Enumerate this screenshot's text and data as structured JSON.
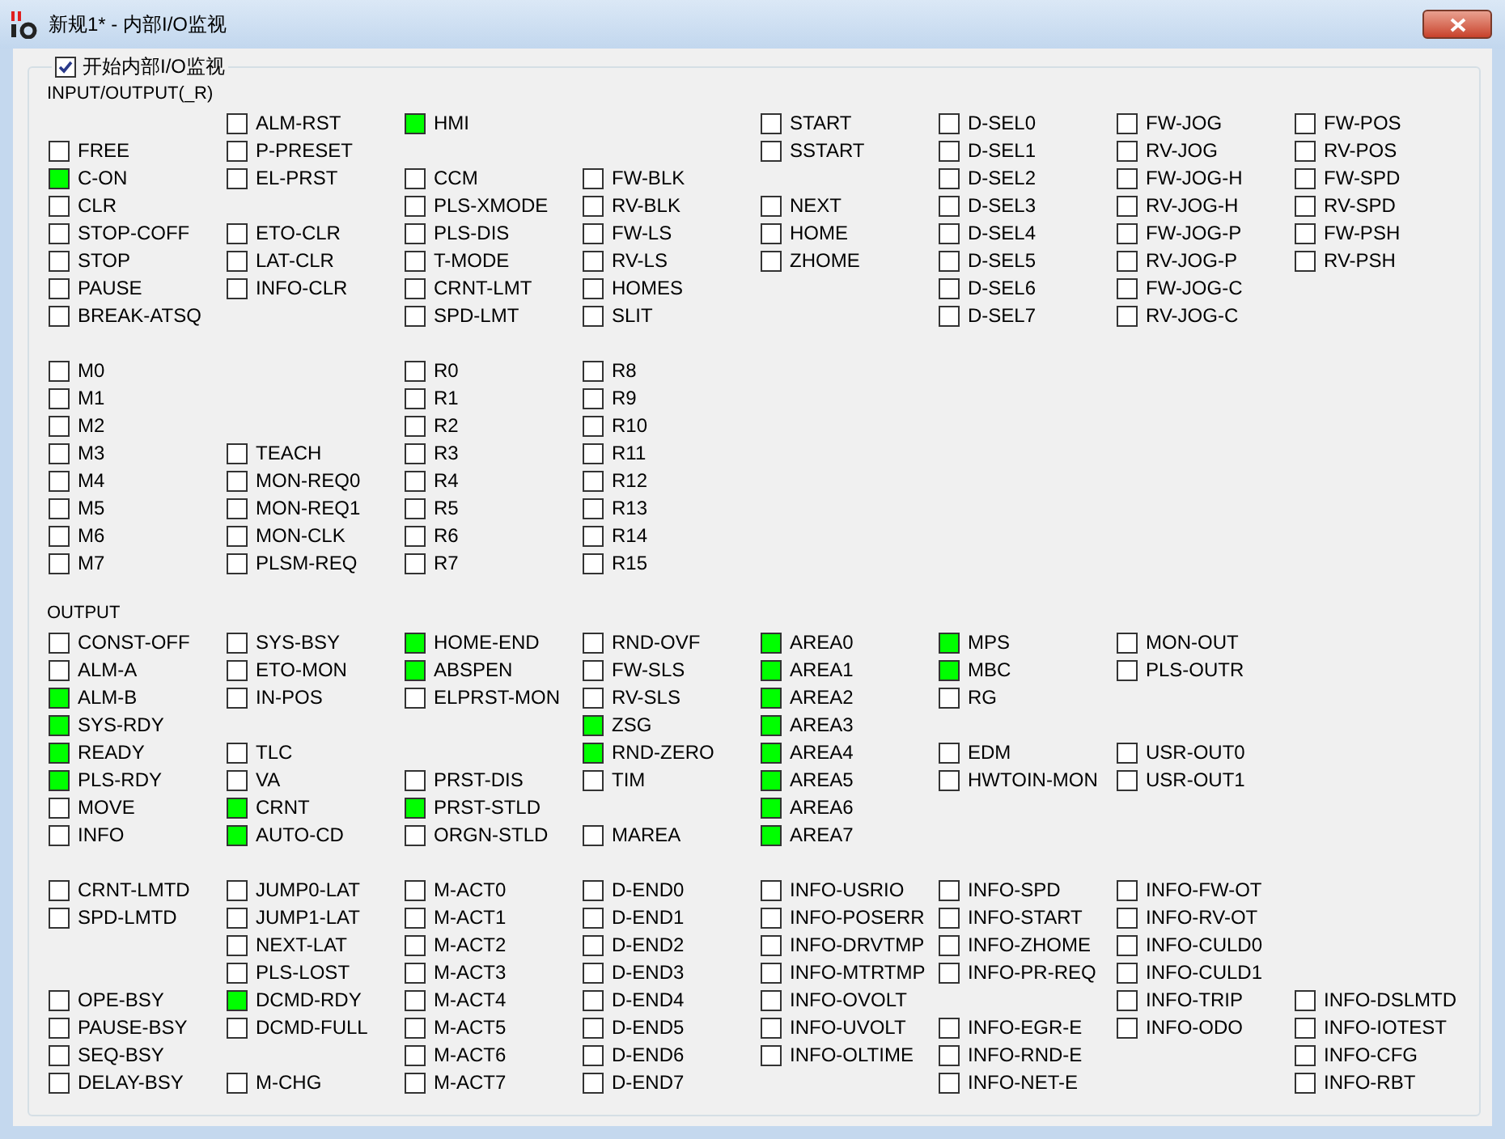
{
  "window": {
    "title": "新规1* - 内部I/O监视"
  },
  "monitor_toggle": {
    "label": "开始内部I/O监视",
    "checked": true
  },
  "sections": [
    {
      "title": "INPUT/OUTPUT(_R)",
      "rows": [
        {
          "kind": "row",
          "cells": [
            {
              "kind": "empty"
            },
            {
              "kind": "indicator",
              "label": "ALM-RST",
              "on": false
            },
            {
              "kind": "indicator",
              "label": "HMI",
              "on": true
            },
            {
              "kind": "empty"
            },
            {
              "kind": "indicator",
              "label": "START",
              "on": false
            },
            {
              "kind": "indicator",
              "label": "D-SEL0",
              "on": false
            },
            {
              "kind": "indicator",
              "label": "FW-JOG",
              "on": false
            },
            {
              "kind": "indicator",
              "label": "FW-POS",
              "on": false
            }
          ]
        },
        {
          "kind": "row",
          "cells": [
            {
              "kind": "indicator",
              "label": "FREE",
              "on": false
            },
            {
              "kind": "indicator",
              "label": "P-PRESET",
              "on": false
            },
            {
              "kind": "empty"
            },
            {
              "kind": "empty"
            },
            {
              "kind": "indicator",
              "label": "SSTART",
              "on": false
            },
            {
              "kind": "indicator",
              "label": "D-SEL1",
              "on": false
            },
            {
              "kind": "indicator",
              "label": "RV-JOG",
              "on": false
            },
            {
              "kind": "indicator",
              "label": "RV-POS",
              "on": false
            }
          ]
        },
        {
          "kind": "row",
          "cells": [
            {
              "kind": "indicator",
              "label": "C-ON",
              "on": true
            },
            {
              "kind": "indicator",
              "label": "EL-PRST",
              "on": false
            },
            {
              "kind": "indicator",
              "label": "CCM",
              "on": false
            },
            {
              "kind": "indicator",
              "label": "FW-BLK",
              "on": false
            },
            {
              "kind": "empty"
            },
            {
              "kind": "indicator",
              "label": "D-SEL2",
              "on": false
            },
            {
              "kind": "indicator",
              "label": "FW-JOG-H",
              "on": false
            },
            {
              "kind": "indicator",
              "label": "FW-SPD",
              "on": false
            }
          ]
        },
        {
          "kind": "row",
          "cells": [
            {
              "kind": "indicator",
              "label": "CLR",
              "on": false
            },
            {
              "kind": "empty"
            },
            {
              "kind": "indicator",
              "label": "PLS-XMODE",
              "on": false
            },
            {
              "kind": "indicator",
              "label": "RV-BLK",
              "on": false
            },
            {
              "kind": "indicator",
              "label": "NEXT",
              "on": false
            },
            {
              "kind": "indicator",
              "label": "D-SEL3",
              "on": false
            },
            {
              "kind": "indicator",
              "label": "RV-JOG-H",
              "on": false
            },
            {
              "kind": "indicator",
              "label": "RV-SPD",
              "on": false
            }
          ]
        },
        {
          "kind": "row",
          "cells": [
            {
              "kind": "indicator",
              "label": "STOP-COFF",
              "on": false
            },
            {
              "kind": "indicator",
              "label": "ETO-CLR",
              "on": false
            },
            {
              "kind": "indicator",
              "label": "PLS-DIS",
              "on": false
            },
            {
              "kind": "indicator",
              "label": "FW-LS",
              "on": false
            },
            {
              "kind": "indicator",
              "label": "HOME",
              "on": false
            },
            {
              "kind": "indicator",
              "label": "D-SEL4",
              "on": false
            },
            {
              "kind": "indicator",
              "label": "FW-JOG-P",
              "on": false
            },
            {
              "kind": "indicator",
              "label": "FW-PSH",
              "on": false
            }
          ]
        },
        {
          "kind": "row",
          "cells": [
            {
              "kind": "indicator",
              "label": "STOP",
              "on": false
            },
            {
              "kind": "indicator",
              "label": "LAT-CLR",
              "on": false
            },
            {
              "kind": "indicator",
              "label": "T-MODE",
              "on": false
            },
            {
              "kind": "indicator",
              "label": "RV-LS",
              "on": false
            },
            {
              "kind": "indicator",
              "label": "ZHOME",
              "on": false
            },
            {
              "kind": "indicator",
              "label": "D-SEL5",
              "on": false
            },
            {
              "kind": "indicator",
              "label": "RV-JOG-P",
              "on": false
            },
            {
              "kind": "indicator",
              "label": "RV-PSH",
              "on": false
            }
          ]
        },
        {
          "kind": "row",
          "cells": [
            {
              "kind": "indicator",
              "label": "PAUSE",
              "on": false
            },
            {
              "kind": "indicator",
              "label": "INFO-CLR",
              "on": false
            },
            {
              "kind": "indicator",
              "label": "CRNT-LMT",
              "on": false
            },
            {
              "kind": "indicator",
              "label": "HOMES",
              "on": false
            },
            {
              "kind": "empty"
            },
            {
              "kind": "indicator",
              "label": "D-SEL6",
              "on": false
            },
            {
              "kind": "indicator",
              "label": "FW-JOG-C",
              "on": false
            }
          ]
        },
        {
          "kind": "row",
          "cells": [
            {
              "kind": "indicator",
              "label": "BREAK-ATSQ",
              "on": false
            },
            {
              "kind": "empty"
            },
            {
              "kind": "indicator",
              "label": "SPD-LMT",
              "on": false
            },
            {
              "kind": "indicator",
              "label": "SLIT",
              "on": false
            },
            {
              "kind": "empty"
            },
            {
              "kind": "indicator",
              "label": "D-SEL7",
              "on": false
            },
            {
              "kind": "indicator",
              "label": "RV-JOG-C",
              "on": false
            }
          ]
        },
        {
          "kind": "spacer"
        },
        {
          "kind": "row",
          "cells": [
            {
              "kind": "indicator",
              "label": "M0",
              "on": false
            },
            {
              "kind": "empty"
            },
            {
              "kind": "indicator",
              "label": "R0",
              "on": false
            },
            {
              "kind": "indicator",
              "label": "R8",
              "on": false
            }
          ]
        },
        {
          "kind": "row",
          "cells": [
            {
              "kind": "indicator",
              "label": "M1",
              "on": false
            },
            {
              "kind": "empty"
            },
            {
              "kind": "indicator",
              "label": "R1",
              "on": false
            },
            {
              "kind": "indicator",
              "label": "R9",
              "on": false
            }
          ]
        },
        {
          "kind": "row",
          "cells": [
            {
              "kind": "indicator",
              "label": "M2",
              "on": false
            },
            {
              "kind": "empty"
            },
            {
              "kind": "indicator",
              "label": "R2",
              "on": false
            },
            {
              "kind": "indicator",
              "label": "R10",
              "on": false
            }
          ]
        },
        {
          "kind": "row",
          "cells": [
            {
              "kind": "indicator",
              "label": "M3",
              "on": false
            },
            {
              "kind": "indicator",
              "label": "TEACH",
              "on": false
            },
            {
              "kind": "indicator",
              "label": "R3",
              "on": false
            },
            {
              "kind": "indicator",
              "label": "R11",
              "on": false
            }
          ]
        },
        {
          "kind": "row",
          "cells": [
            {
              "kind": "indicator",
              "label": "M4",
              "on": false
            },
            {
              "kind": "indicator",
              "label": "MON-REQ0",
              "on": false
            },
            {
              "kind": "indicator",
              "label": "R4",
              "on": false
            },
            {
              "kind": "indicator",
              "label": "R12",
              "on": false
            }
          ]
        },
        {
          "kind": "row",
          "cells": [
            {
              "kind": "indicator",
              "label": "M5",
              "on": false
            },
            {
              "kind": "indicator",
              "label": "MON-REQ1",
              "on": false
            },
            {
              "kind": "indicator",
              "label": "R5",
              "on": false
            },
            {
              "kind": "indicator",
              "label": "R13",
              "on": false
            }
          ]
        },
        {
          "kind": "row",
          "cells": [
            {
              "kind": "indicator",
              "label": "M6",
              "on": false
            },
            {
              "kind": "indicator",
              "label": "MON-CLK",
              "on": false
            },
            {
              "kind": "indicator",
              "label": "R6",
              "on": false
            },
            {
              "kind": "indicator",
              "label": "R14",
              "on": false
            }
          ]
        },
        {
          "kind": "row",
          "cells": [
            {
              "kind": "indicator",
              "label": "M7",
              "on": false
            },
            {
              "kind": "indicator",
              "label": "PLSM-REQ",
              "on": false
            },
            {
              "kind": "indicator",
              "label": "R7",
              "on": false
            },
            {
              "kind": "indicator",
              "label": "R15",
              "on": false
            }
          ]
        }
      ]
    },
    {
      "title": "OUTPUT",
      "rows": [
        {
          "kind": "row",
          "cells": [
            {
              "kind": "indicator",
              "label": "CONST-OFF",
              "on": false
            },
            {
              "kind": "indicator",
              "label": "SYS-BSY",
              "on": false
            },
            {
              "kind": "indicator",
              "label": "HOME-END",
              "on": true
            },
            {
              "kind": "indicator",
              "label": "RND-OVF",
              "on": false
            },
            {
              "kind": "indicator",
              "label": "AREA0",
              "on": true
            },
            {
              "kind": "indicator",
              "label": "MPS",
              "on": true
            },
            {
              "kind": "indicator",
              "label": "MON-OUT",
              "on": false
            }
          ]
        },
        {
          "kind": "row",
          "cells": [
            {
              "kind": "indicator",
              "label": "ALM-A",
              "on": false
            },
            {
              "kind": "indicator",
              "label": "ETO-MON",
              "on": false
            },
            {
              "kind": "indicator",
              "label": "ABSPEN",
              "on": true
            },
            {
              "kind": "indicator",
              "label": "FW-SLS",
              "on": false
            },
            {
              "kind": "indicator",
              "label": "AREA1",
              "on": true
            },
            {
              "kind": "indicator",
              "label": "MBC",
              "on": true
            },
            {
              "kind": "indicator",
              "label": "PLS-OUTR",
              "on": false
            }
          ]
        },
        {
          "kind": "row",
          "cells": [
            {
              "kind": "indicator",
              "label": "ALM-B",
              "on": true
            },
            {
              "kind": "indicator",
              "label": "IN-POS",
              "on": false
            },
            {
              "kind": "indicator",
              "label": "ELPRST-MON",
              "on": false
            },
            {
              "kind": "indicator",
              "label": "RV-SLS",
              "on": false
            },
            {
              "kind": "indicator",
              "label": "AREA2",
              "on": true
            },
            {
              "kind": "indicator",
              "label": "RG",
              "on": false
            }
          ]
        },
        {
          "kind": "row",
          "cells": [
            {
              "kind": "indicator",
              "label": "SYS-RDY",
              "on": true
            },
            {
              "kind": "empty"
            },
            {
              "kind": "empty"
            },
            {
              "kind": "indicator",
              "label": "ZSG",
              "on": true
            },
            {
              "kind": "indicator",
              "label": "AREA3",
              "on": true
            }
          ]
        },
        {
          "kind": "row",
          "cells": [
            {
              "kind": "indicator",
              "label": "READY",
              "on": true
            },
            {
              "kind": "indicator",
              "label": "TLC",
              "on": false
            },
            {
              "kind": "empty"
            },
            {
              "kind": "indicator",
              "label": "RND-ZERO",
              "on": true
            },
            {
              "kind": "indicator",
              "label": "AREA4",
              "on": true
            },
            {
              "kind": "indicator",
              "label": "EDM",
              "on": false
            },
            {
              "kind": "indicator",
              "label": "USR-OUT0",
              "on": false
            }
          ]
        },
        {
          "kind": "row",
          "cells": [
            {
              "kind": "indicator",
              "label": "PLS-RDY",
              "on": true
            },
            {
              "kind": "indicator",
              "label": "VA",
              "on": false
            },
            {
              "kind": "indicator",
              "label": "PRST-DIS",
              "on": false
            },
            {
              "kind": "indicator",
              "label": "TIM",
              "on": false
            },
            {
              "kind": "indicator",
              "label": "AREA5",
              "on": true
            },
            {
              "kind": "indicator",
              "label": "HWTOIN-MON",
              "on": false
            },
            {
              "kind": "indicator",
              "label": "USR-OUT1",
              "on": false
            }
          ]
        },
        {
          "kind": "row",
          "cells": [
            {
              "kind": "indicator",
              "label": "MOVE",
              "on": false
            },
            {
              "kind": "indicator",
              "label": "CRNT",
              "on": true
            },
            {
              "kind": "indicator",
              "label": "PRST-STLD",
              "on": true
            },
            {
              "kind": "empty"
            },
            {
              "kind": "indicator",
              "label": "AREA6",
              "on": true
            }
          ]
        },
        {
          "kind": "row",
          "cells": [
            {
              "kind": "indicator",
              "label": "INFO",
              "on": false
            },
            {
              "kind": "indicator",
              "label": "AUTO-CD",
              "on": true
            },
            {
              "kind": "indicator",
              "label": "ORGN-STLD",
              "on": false
            },
            {
              "kind": "indicator",
              "label": "MAREA",
              "on": false
            },
            {
              "kind": "indicator",
              "label": "AREA7",
              "on": true
            }
          ]
        },
        {
          "kind": "spacer"
        },
        {
          "kind": "row",
          "cells": [
            {
              "kind": "indicator",
              "label": "CRNT-LMTD",
              "on": false
            },
            {
              "kind": "indicator",
              "label": "JUMP0-LAT",
              "on": false
            },
            {
              "kind": "indicator",
              "label": "M-ACT0",
              "on": false
            },
            {
              "kind": "indicator",
              "label": "D-END0",
              "on": false
            },
            {
              "kind": "indicator",
              "label": "INFO-USRIO",
              "on": false
            },
            {
              "kind": "indicator",
              "label": "INFO-SPD",
              "on": false
            },
            {
              "kind": "indicator",
              "label": "INFO-FW-OT",
              "on": false
            }
          ]
        },
        {
          "kind": "row",
          "cells": [
            {
              "kind": "indicator",
              "label": "SPD-LMTD",
              "on": false
            },
            {
              "kind": "indicator",
              "label": "JUMP1-LAT",
              "on": false
            },
            {
              "kind": "indicator",
              "label": "M-ACT1",
              "on": false
            },
            {
              "kind": "indicator",
              "label": "D-END1",
              "on": false
            },
            {
              "kind": "indicator",
              "label": "INFO-POSERR",
              "on": false
            },
            {
              "kind": "indicator",
              "label": "INFO-START",
              "on": false
            },
            {
              "kind": "indicator",
              "label": "INFO-RV-OT",
              "on": false
            }
          ]
        },
        {
          "kind": "row",
          "cells": [
            {
              "kind": "empty"
            },
            {
              "kind": "indicator",
              "label": "NEXT-LAT",
              "on": false
            },
            {
              "kind": "indicator",
              "label": "M-ACT2",
              "on": false
            },
            {
              "kind": "indicator",
              "label": "D-END2",
              "on": false
            },
            {
              "kind": "indicator",
              "label": "INFO-DRVTMP",
              "on": false
            },
            {
              "kind": "indicator",
              "label": "INFO-ZHOME",
              "on": false
            },
            {
              "kind": "indicator",
              "label": "INFO-CULD0",
              "on": false
            }
          ]
        },
        {
          "kind": "row",
          "cells": [
            {
              "kind": "empty"
            },
            {
              "kind": "indicator",
              "label": "PLS-LOST",
              "on": false
            },
            {
              "kind": "indicator",
              "label": "M-ACT3",
              "on": false
            },
            {
              "kind": "indicator",
              "label": "D-END3",
              "on": false
            },
            {
              "kind": "indicator",
              "label": "INFO-MTRTMP",
              "on": false
            },
            {
              "kind": "indicator",
              "label": "INFO-PR-REQ",
              "on": false
            },
            {
              "kind": "indicator",
              "label": "INFO-CULD1",
              "on": false
            }
          ]
        },
        {
          "kind": "row",
          "cells": [
            {
              "kind": "indicator",
              "label": "OPE-BSY",
              "on": false
            },
            {
              "kind": "indicator",
              "label": "DCMD-RDY",
              "on": true
            },
            {
              "kind": "indicator",
              "label": "M-ACT4",
              "on": false
            },
            {
              "kind": "indicator",
              "label": "D-END4",
              "on": false
            },
            {
              "kind": "indicator",
              "label": "INFO-OVOLT",
              "on": false
            },
            {
              "kind": "empty"
            },
            {
              "kind": "indicator",
              "label": "INFO-TRIP",
              "on": false
            },
            {
              "kind": "indicator",
              "label": "INFO-DSLMTD",
              "on": false
            }
          ]
        },
        {
          "kind": "row",
          "cells": [
            {
              "kind": "indicator",
              "label": "PAUSE-BSY",
              "on": false
            },
            {
              "kind": "indicator",
              "label": "DCMD-FULL",
              "on": false
            },
            {
              "kind": "indicator",
              "label": "M-ACT5",
              "on": false
            },
            {
              "kind": "indicator",
              "label": "D-END5",
              "on": false
            },
            {
              "kind": "indicator",
              "label": "INFO-UVOLT",
              "on": false
            },
            {
              "kind": "indicator",
              "label": "INFO-EGR-E",
              "on": false
            },
            {
              "kind": "indicator",
              "label": "INFO-ODO",
              "on": false
            },
            {
              "kind": "indicator",
              "label": "INFO-IOTEST",
              "on": false
            }
          ]
        },
        {
          "kind": "row",
          "cells": [
            {
              "kind": "indicator",
              "label": "SEQ-BSY",
              "on": false
            },
            {
              "kind": "empty"
            },
            {
              "kind": "indicator",
              "label": "M-ACT6",
              "on": false
            },
            {
              "kind": "indicator",
              "label": "D-END6",
              "on": false
            },
            {
              "kind": "indicator",
              "label": "INFO-OLTIME",
              "on": false
            },
            {
              "kind": "indicator",
              "label": "INFO-RND-E",
              "on": false
            },
            {
              "kind": "empty"
            },
            {
              "kind": "indicator",
              "label": "INFO-CFG",
              "on": false
            }
          ]
        },
        {
          "kind": "row",
          "cells": [
            {
              "kind": "indicator",
              "label": "DELAY-BSY",
              "on": false
            },
            {
              "kind": "indicator",
              "label": "M-CHG",
              "on": false
            },
            {
              "kind": "indicator",
              "label": "M-ACT7",
              "on": false
            },
            {
              "kind": "indicator",
              "label": "D-END7",
              "on": false
            },
            {
              "kind": "empty"
            },
            {
              "kind": "indicator",
              "label": "INFO-NET-E",
              "on": false
            },
            {
              "kind": "empty"
            },
            {
              "kind": "indicator",
              "label": "INFO-RBT",
              "on": false
            }
          ]
        }
      ]
    }
  ]
}
